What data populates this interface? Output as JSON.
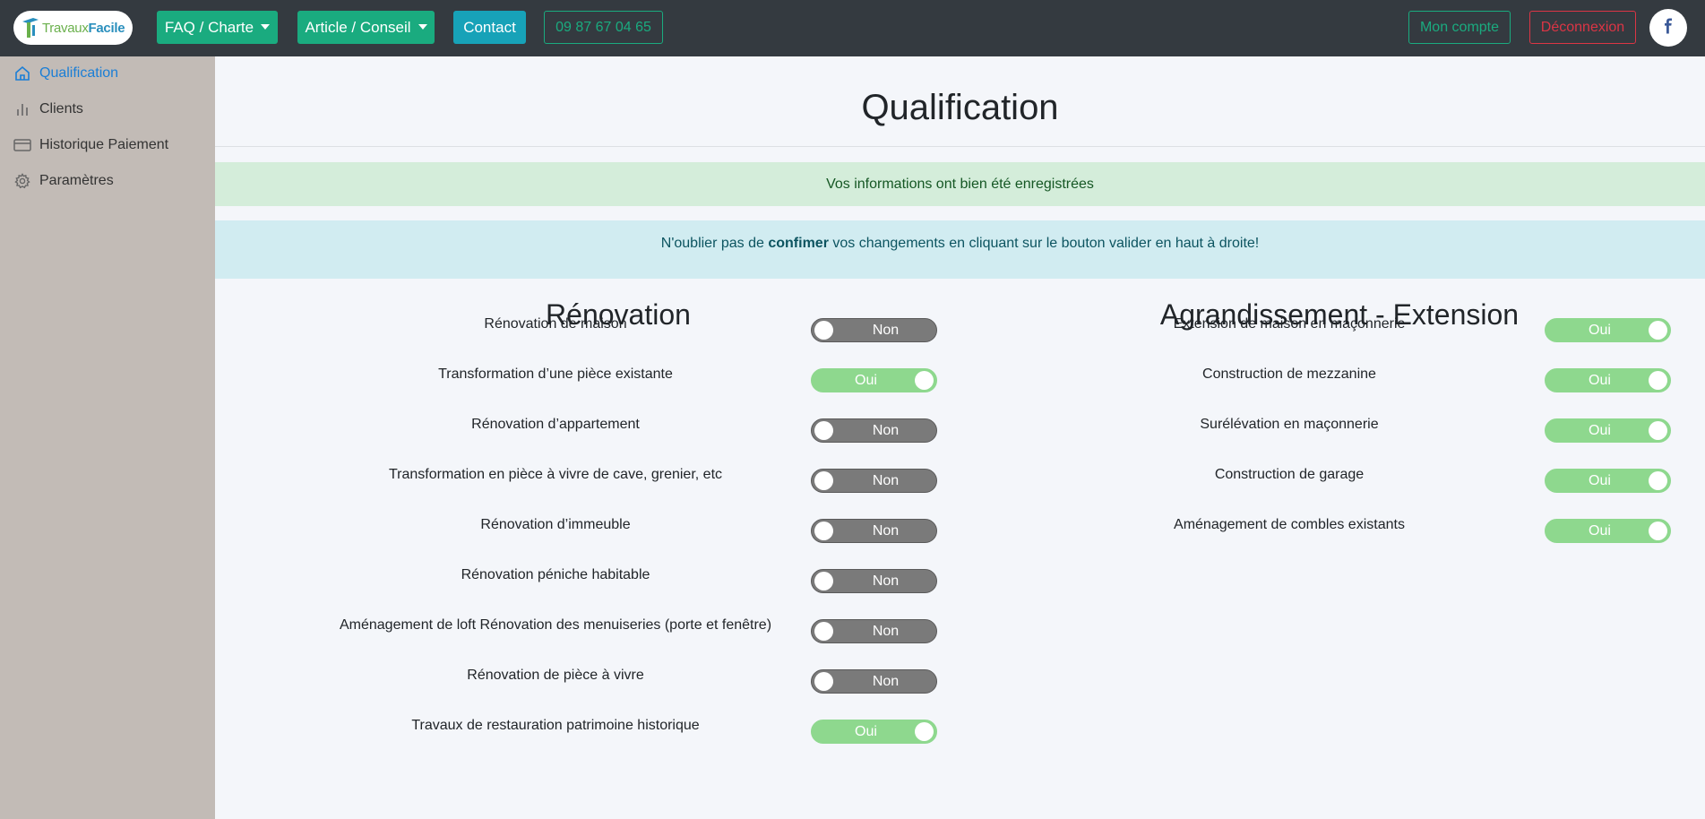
{
  "navbar": {
    "logo_text_1": "Travaux",
    "logo_text_2": "Facile",
    "faq_label": "FAQ / Charte",
    "article_label": "Article / Conseil",
    "contact_label": "Contact",
    "phone_label": "09 87 67 04 65",
    "account_label": "Mon compte",
    "logout_label": "Déconnexion",
    "facebook_icon": "facebook-icon"
  },
  "sidebar": {
    "items": [
      {
        "label": "Qualification",
        "icon": "home-icon",
        "active": true
      },
      {
        "label": "Clients",
        "icon": "bar-chart-icon",
        "active": false
      },
      {
        "label": "Historique Paiement",
        "icon": "credit-card-icon",
        "active": false
      },
      {
        "label": "Paramètres",
        "icon": "gear-icon",
        "active": false
      }
    ]
  },
  "main": {
    "title": "Qualification",
    "alert_success": "Vos informations ont bien été enregistrées",
    "alert_info": {
      "before": "N'oublier pas de ",
      "bold": "confimer",
      "after": " vos changements en cliquant sur le bouton valider en haut à droite!"
    },
    "colors": {
      "toggle_on": "#8ed88e",
      "toggle_off": "#7a7a7a",
      "accent_green": "#1aab7f",
      "danger": "#dc3545"
    },
    "renovation": {
      "title": "Rénovation",
      "items": [
        {
          "label": "Rénovation de maison",
          "state": "Non"
        },
        {
          "label": "Transformation d’une pièce existante",
          "state": "Oui"
        },
        {
          "label": "Rénovation d’appartement",
          "state": "Non"
        },
        {
          "label": "Transformation en pièce à vivre de cave, grenier, etc",
          "state": "Non"
        },
        {
          "label": "Rénovation d’immeuble",
          "state": "Non"
        },
        {
          "label": "Rénovation péniche habitable",
          "state": "Non"
        },
        {
          "label": "Aménagement de loft Rénovation des menuiseries (porte et fenêtre)",
          "state": "Non"
        },
        {
          "label": "Rénovation de pièce à vivre",
          "state": "Non"
        },
        {
          "label": "Travaux de restauration patrimoine historique",
          "state": "Oui"
        }
      ]
    },
    "extension": {
      "title": "Agrandissement - Extension",
      "items": [
        {
          "label": "Extension de maison en maçonnerie",
          "state": "Oui"
        },
        {
          "label": "Construction de mezzanine",
          "state": "Oui"
        },
        {
          "label": "Surélévation en maçonnerie",
          "state": "Oui"
        },
        {
          "label": "Construction de garage",
          "state": "Oui"
        },
        {
          "label": "Aménagement de combles existants",
          "state": "Oui"
        }
      ]
    }
  }
}
